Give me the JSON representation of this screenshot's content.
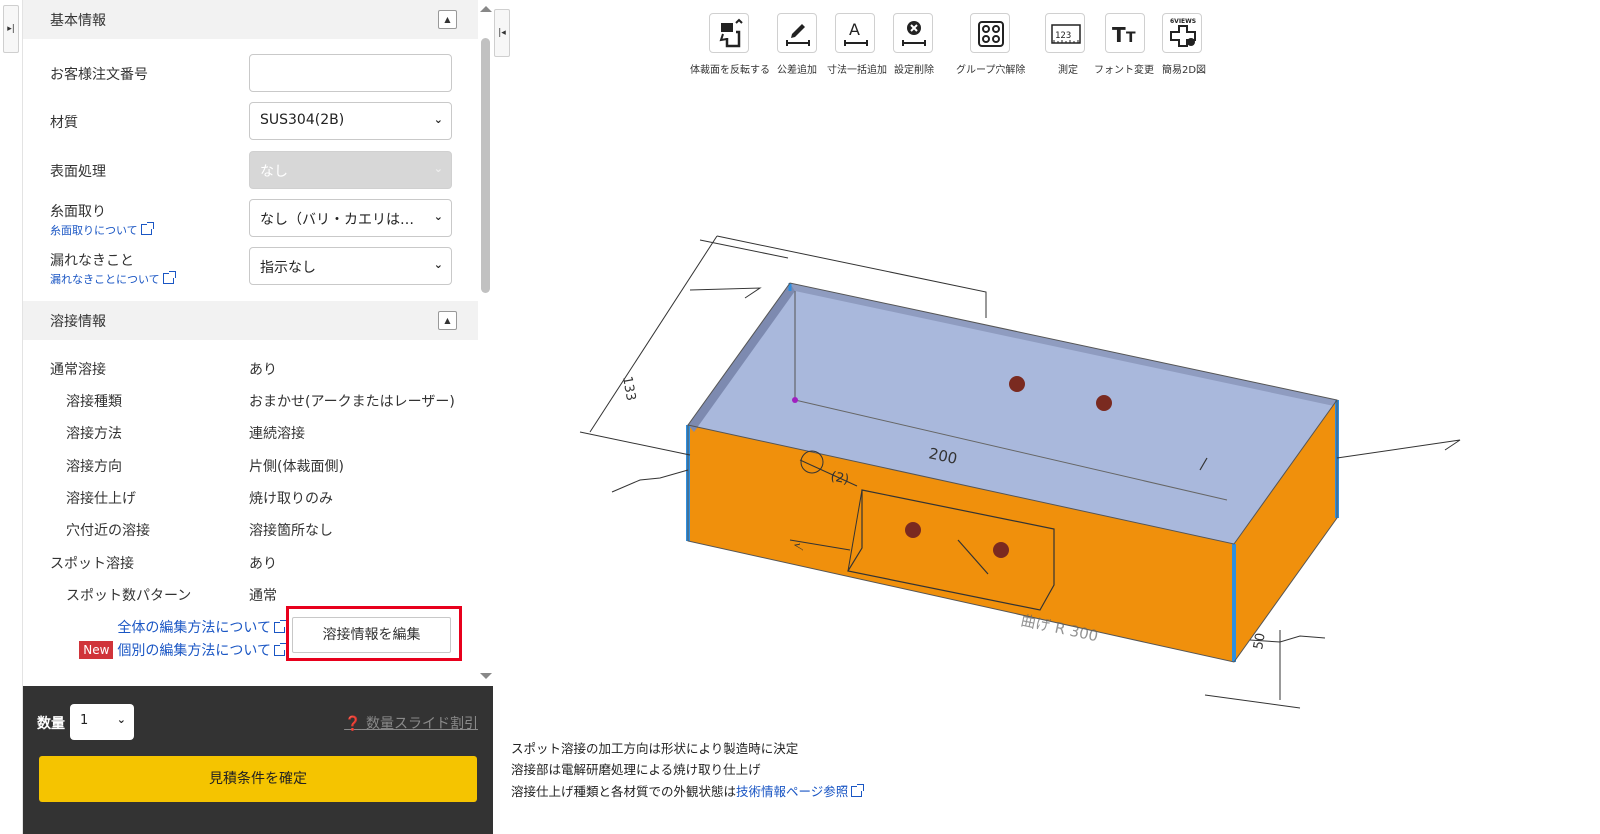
{
  "panel": {
    "basic_section_title": "基本情報",
    "order_no_label": "お客様注文番号",
    "order_no_value": "",
    "material_label": "材質",
    "material_value": "SUS304(2B)",
    "surface_label": "表面処理",
    "surface_value": "なし",
    "deburr_label": "糸面取り",
    "deburr_link": "糸面取りについて",
    "deburr_value": "なし（バリ・カエリは…",
    "leak_label": "漏れなきこと",
    "leak_link": "漏れなきことについて",
    "leak_value": "指示なし"
  },
  "weld": {
    "section_title": "溶接情報",
    "rows": [
      {
        "label": "通常溶接",
        "value": "あり"
      },
      {
        "label": "溶接種類",
        "value": "おまかせ(アークまたはレーザー)"
      },
      {
        "label": "溶接方法",
        "value": "連続溶接"
      },
      {
        "label": "溶接方向",
        "value": "片側(体裁面側)"
      },
      {
        "label": "溶接仕上げ",
        "value": "焼け取りのみ"
      },
      {
        "label": "穴付近の溶接",
        "value": "溶接箇所なし"
      },
      {
        "label": "スポット溶接",
        "value": "あり"
      },
      {
        "label": "スポット数パターン",
        "value": "通常"
      }
    ],
    "link_all": "全体の編集方法について",
    "new_badge": "New",
    "link_individual": "個別の編集方法について",
    "edit_button": "溶接情報を編集"
  },
  "bottom": {
    "qty_label": "数量",
    "qty_value": "1",
    "discount_link": "数量スライド割引",
    "confirm_button": "見積条件を確定"
  },
  "toolbar": [
    {
      "label": "体裁面を反転する",
      "icon": "flip-face-icon"
    },
    {
      "label": "公差追加",
      "icon": "pencil-dimension-icon"
    },
    {
      "label": "寸法一括追加",
      "icon": "letter-a-dimension-icon"
    },
    {
      "label": "設定削除",
      "icon": "delete-setting-icon"
    },
    {
      "label": "グループ穴解除",
      "icon": "group-hole-icon"
    },
    {
      "label": "測定",
      "icon": "ruler-icon"
    },
    {
      "label": "フォント変更",
      "icon": "font-icon"
    },
    {
      "label": "簡易2D図",
      "icon": "views-icon",
      "icon_text": "6VIEWS"
    }
  ],
  "model": {
    "dim_200": "200",
    "dim_133": "133",
    "dim_50": "50",
    "dim_2": "(2)",
    "dim_ghost": "曲げ R 300",
    "weld_symbol": "√"
  },
  "notes": {
    "line1": "スポット溶接の加工方向は形状により製造時に決定",
    "line2": "溶接部は電解研磨処理による焼け取り仕上げ",
    "line3_prefix": "溶接仕上げ種類と各材質での外観状態は",
    "line3_link": "技術情報ページ参照"
  },
  "colors": {
    "orange_face": "#f0900c",
    "blue_face": "#a9b8dc",
    "edge_blue": "#2e8fe0",
    "confirm_yellow": "#f5c400",
    "highlight_red": "#e8001c"
  }
}
